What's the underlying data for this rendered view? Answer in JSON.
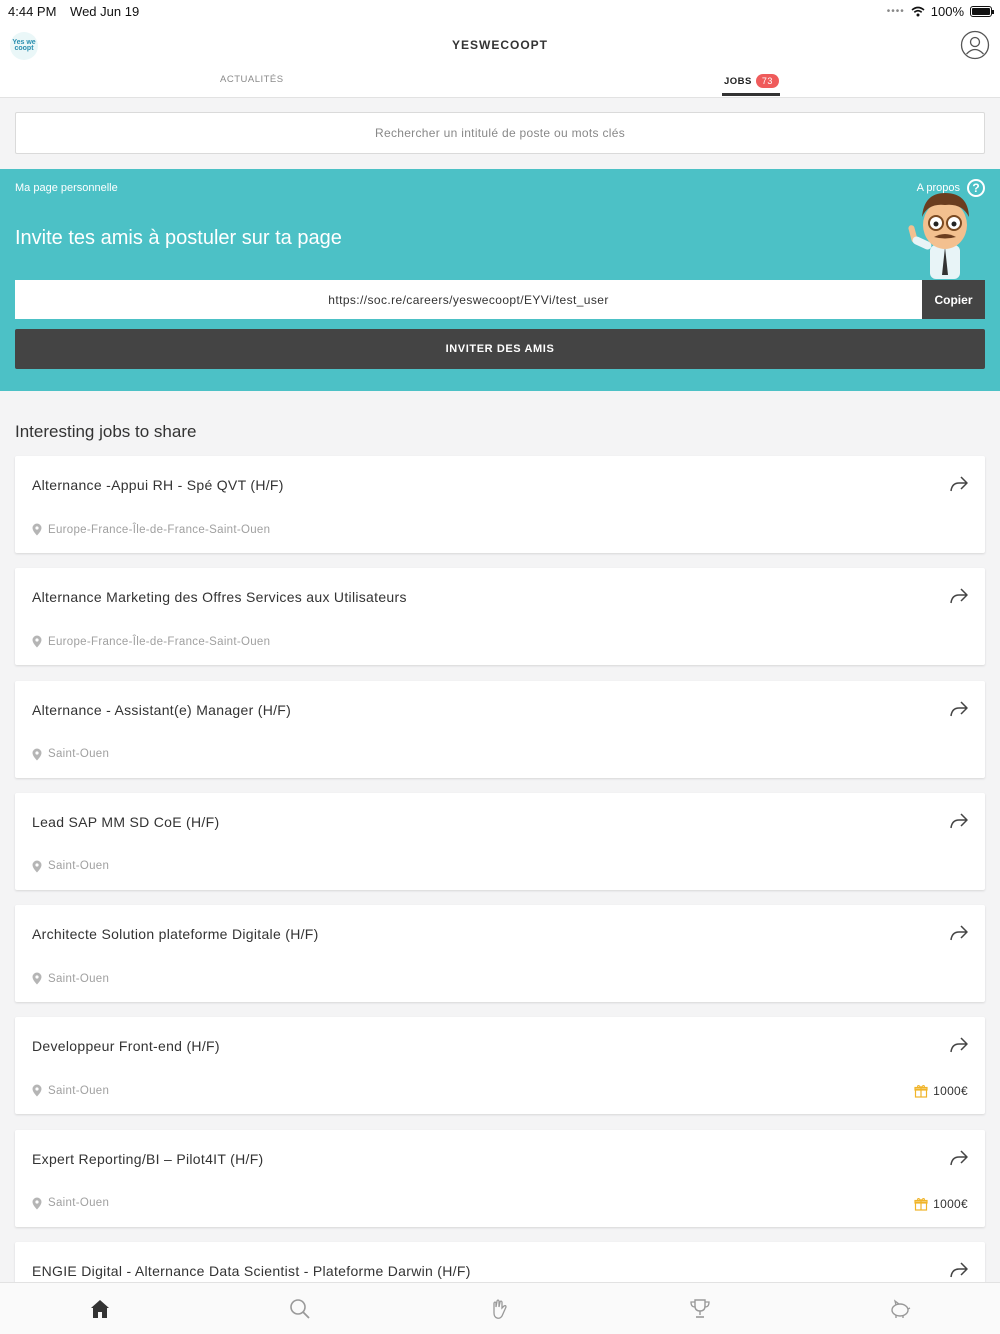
{
  "status": {
    "time": "4:44 PM",
    "date": "Wed Jun 19",
    "battery": "100%"
  },
  "header": {
    "logo_text": "Yes we coopt",
    "title": "YESWECOOPT",
    "tabs": [
      {
        "label": "ACTUALITÉS",
        "active": false
      },
      {
        "label": "JOBS",
        "badge": "73",
        "active": true
      }
    ]
  },
  "search": {
    "placeholder": "Rechercher un intitulé de poste ou mots clés"
  },
  "invite": {
    "personal_label": "Ma page personnelle",
    "about_label": "A propos",
    "heading": "Invite tes amis à postuler sur ta page",
    "link": "https://soc.re/careers/yeswecoopt/EYVi/test_user",
    "copy_label": "Copier",
    "invite_button": "INVITER DES AMIS"
  },
  "section_title": "Interesting jobs to share",
  "jobs": [
    {
      "title": "Alternance -Appui RH - Spé QVT (H/F)",
      "location": "Europe-France-Île-de-France-Saint-Ouen",
      "reward": ""
    },
    {
      "title": "Alternance Marketing des Offres Services aux Utilisateurs",
      "location": "Europe-France-Île-de-France-Saint-Ouen",
      "reward": ""
    },
    {
      "title": "Alternance - Assistant(e) Manager (H/F)",
      "location": "Saint-Ouen",
      "reward": ""
    },
    {
      "title": "Lead SAP MM SD CoE (H/F)",
      "location": "Saint-Ouen",
      "reward": ""
    },
    {
      "title": "Architecte Solution plateforme Digitale (H/F)",
      "location": "Saint-Ouen",
      "reward": ""
    },
    {
      "title": "Developpeur Front-end (H/F)",
      "location": "Saint-Ouen",
      "reward": "1000€"
    },
    {
      "title": "Expert Reporting/BI – Pilot4IT (H/F)",
      "location": "Saint-Ouen",
      "reward": "1000€"
    },
    {
      "title": "ENGIE Digital - Alternance Data Scientist - Plateforme Darwin (H/F)",
      "location": "",
      "reward": ""
    }
  ],
  "bottom_nav": [
    {
      "icon": "home-icon",
      "active": true
    },
    {
      "icon": "search-icon",
      "active": false
    },
    {
      "icon": "clap-icon",
      "active": false
    },
    {
      "icon": "trophy-icon",
      "active": false
    },
    {
      "icon": "piggy-bank-icon",
      "active": false
    }
  ],
  "colors": {
    "accent": "#4cc1c6",
    "dark": "#444444",
    "badge": "#ef5b5b",
    "reward_icon": "#f0b429"
  }
}
